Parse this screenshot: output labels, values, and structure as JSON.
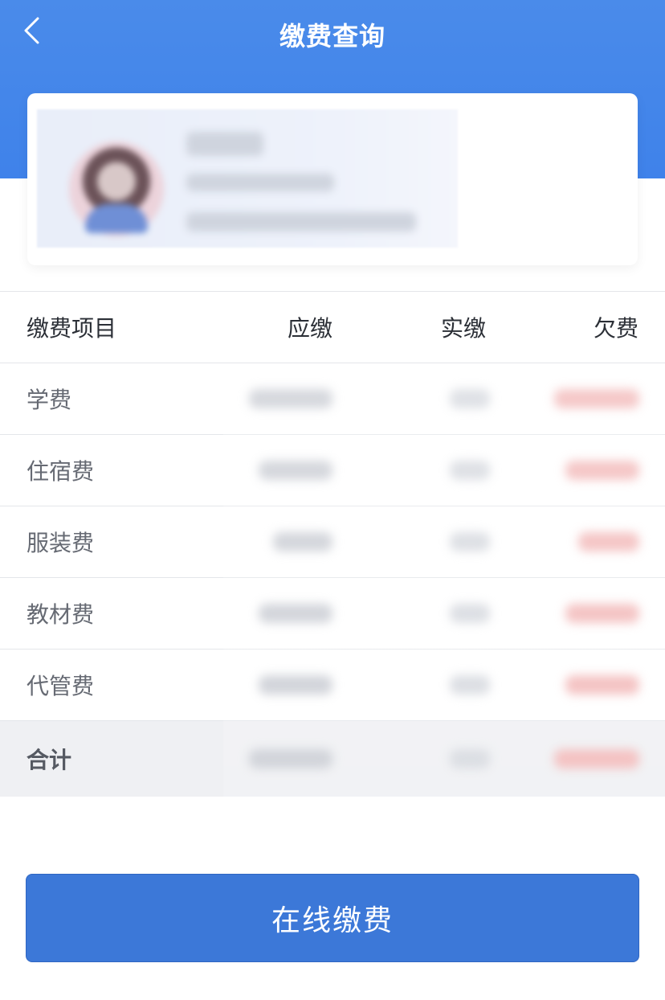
{
  "header": {
    "title": "缴费查询",
    "back_icon": "chevron-left-icon"
  },
  "colors": {
    "header_blue": "#4a8bea",
    "button_blue": "#3c78d8",
    "owed_red": "#e76a6a"
  },
  "table": {
    "headers": [
      "缴费项目",
      "应缴",
      "实缴",
      "欠费"
    ],
    "rows": [
      {
        "label": "学费"
      },
      {
        "label": "住宿费"
      },
      {
        "label": "服装费"
      },
      {
        "label": "教材费"
      },
      {
        "label": "代管费"
      }
    ],
    "total_label": "合计"
  },
  "pay_button": {
    "label": "在线缴费"
  }
}
